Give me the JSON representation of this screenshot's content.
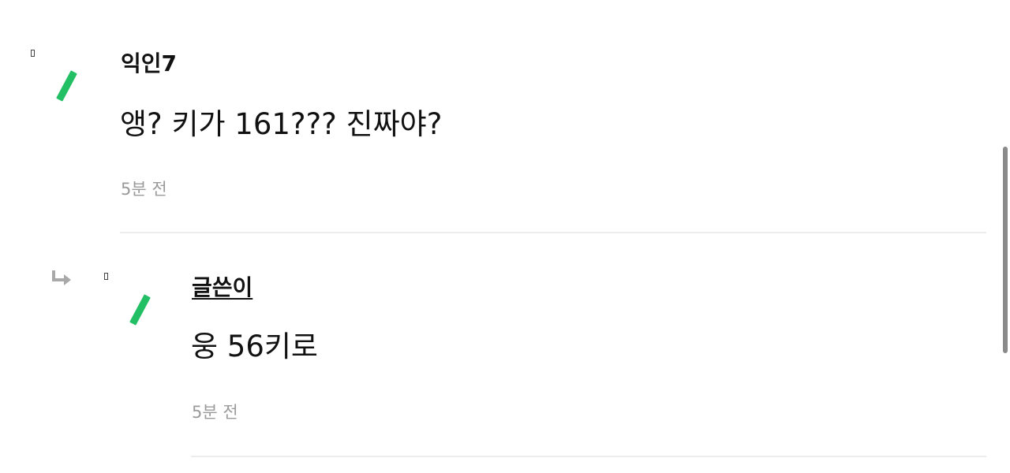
{
  "comments": [
    {
      "author": "익인7",
      "text": "앵? 키가 161??? 진짜야?",
      "time": "5분 전"
    }
  ],
  "replies": [
    {
      "author": "글쓴이",
      "text": "웅 56키로",
      "time": "5분 전"
    }
  ],
  "colors": {
    "accent_mark": "#22bf64",
    "timestamp": "#9a9a9a",
    "divider": "#ececec"
  },
  "icons": {
    "reply_indicator": "reply-arrow-icon",
    "level_mark": "green-slash-icon"
  }
}
